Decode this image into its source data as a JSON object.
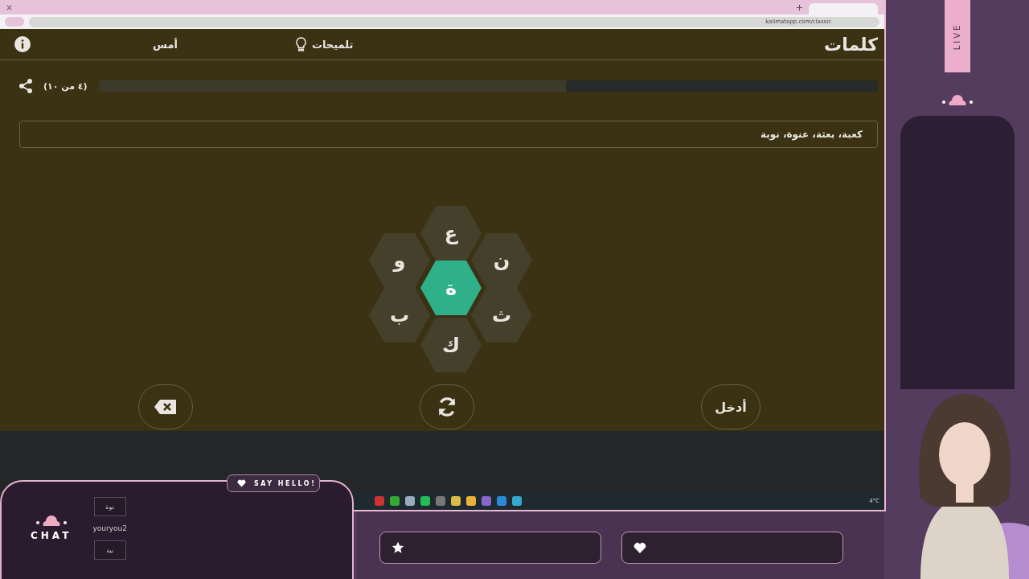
{
  "browser": {
    "url": "kalimatapp.com/classic"
  },
  "header": {
    "logo": "كلمات",
    "hints": "تلميحات",
    "yesterday": "أمس"
  },
  "progress": {
    "label": "(٤ من ١٠)",
    "level": 0.4
  },
  "found_words": "كعبة، بعثة، عنوة، نوبة",
  "hive": {
    "center": "ة",
    "letters": [
      "ع",
      "ن",
      "ث",
      "ك",
      "ب",
      "و"
    ]
  },
  "enter_button": "أدخل",
  "taskbar": {
    "weather": "4°C"
  },
  "overlay": {
    "live": "LIVE",
    "say_hello": "SAY HELLO!",
    "chat_title": "CHAT",
    "chat": [
      {
        "kind": "message",
        "text": "توة"
      },
      {
        "kind": "user",
        "text": "youryou2"
      },
      {
        "kind": "message",
        "text": "نبة"
      }
    ]
  }
}
